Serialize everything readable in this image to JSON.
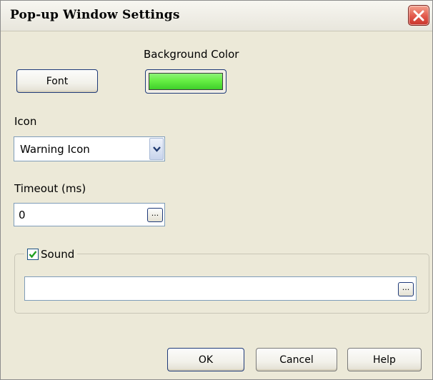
{
  "window": {
    "title": "Pop-up Window Settings"
  },
  "font_button": {
    "label": "Font"
  },
  "background_color": {
    "label": "Background Color",
    "color": "#66ee44"
  },
  "icon": {
    "label": "Icon",
    "selected": "Warning Icon"
  },
  "timeout": {
    "label": "Timeout (ms)",
    "value": "0",
    "browse_label": "..."
  },
  "sound": {
    "label": "Sound",
    "checked": true,
    "path_value": "",
    "browse_label": "..."
  },
  "buttons": {
    "ok": "OK",
    "cancel": "Cancel",
    "help": "Help"
  },
  "icons": {
    "close": "close-icon",
    "dropdown": "chevron-down-icon",
    "check": "check-icon"
  }
}
